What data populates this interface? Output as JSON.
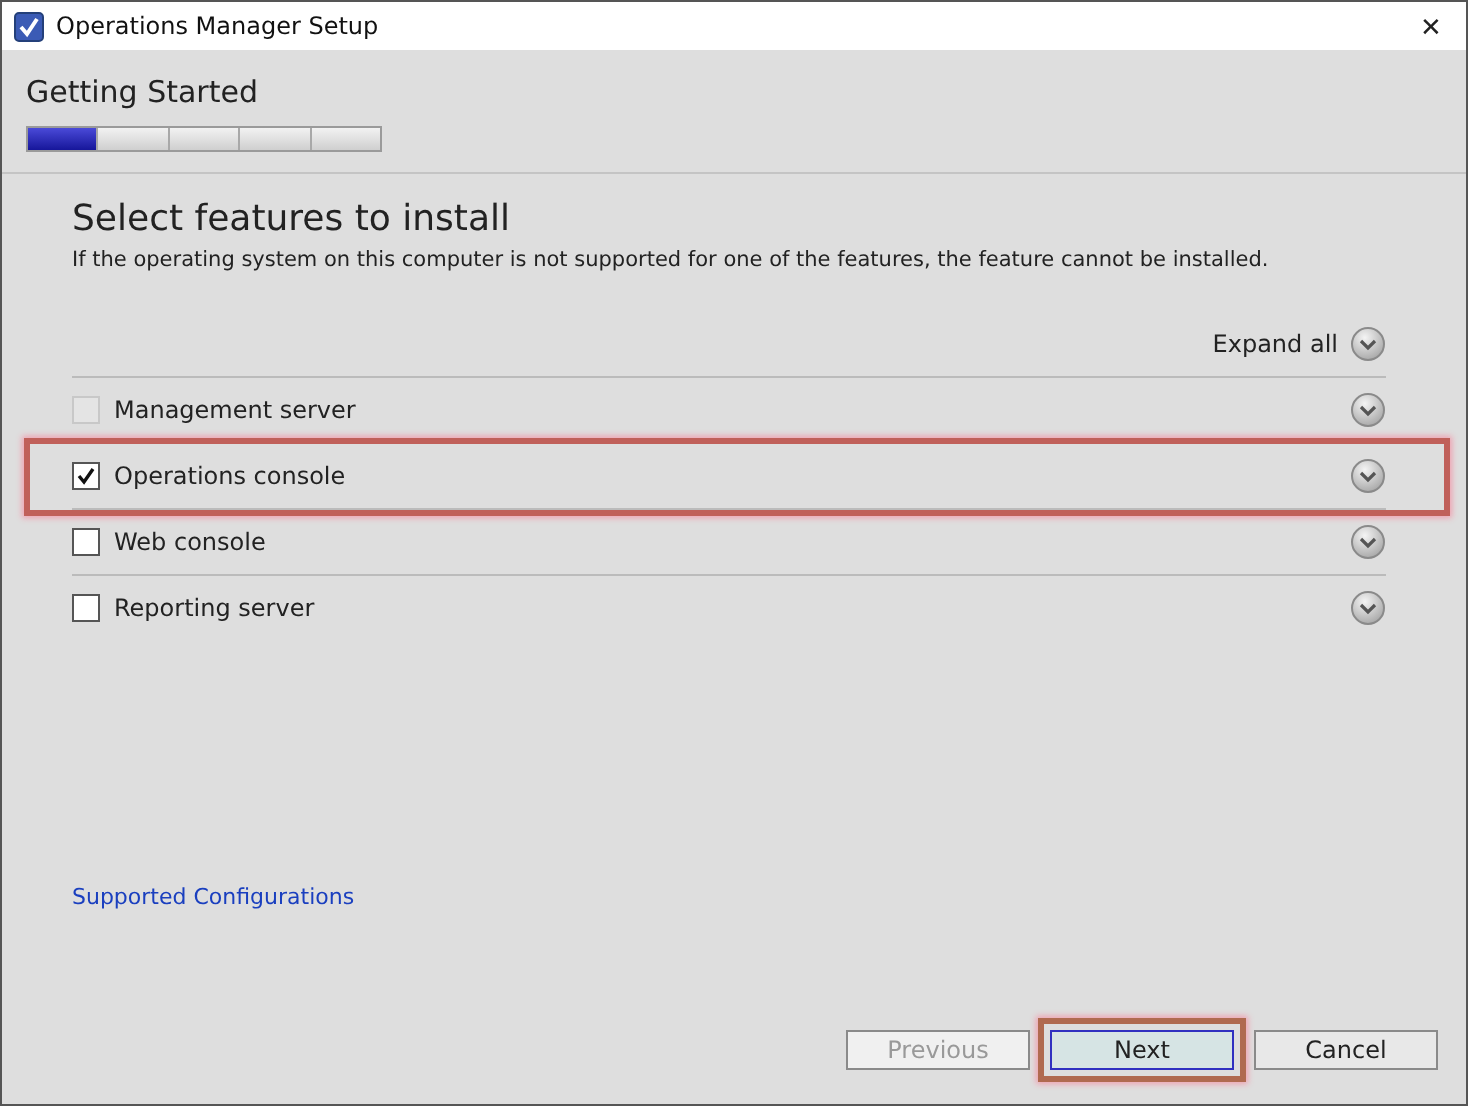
{
  "window": {
    "title": "Operations Manager Setup",
    "close": "✕"
  },
  "stage": {
    "title": "Getting Started",
    "steps": [
      {
        "current": true
      },
      {
        "current": false
      },
      {
        "current": false
      },
      {
        "current": false
      },
      {
        "current": false
      }
    ]
  },
  "heading": "Select features to install",
  "description": "If the operating system on this computer is not supported for one of the features, the feature cannot be installed.",
  "expand_all": "Expand all",
  "features": [
    {
      "label": "Management server",
      "checked": false,
      "disabled": true,
      "highlighted": false
    },
    {
      "label": "Operations console",
      "checked": true,
      "disabled": false,
      "highlighted": true
    },
    {
      "label": "Web console",
      "checked": false,
      "disabled": false,
      "highlighted": false
    },
    {
      "label": "Reporting server",
      "checked": false,
      "disabled": false,
      "highlighted": false
    }
  ],
  "link": "Supported Configurations",
  "buttons": [
    {
      "label": "Previous",
      "disabled": true,
      "default": false,
      "highlighted": false
    },
    {
      "label": "Next",
      "disabled": false,
      "default": true,
      "highlighted": true
    },
    {
      "label": "Cancel",
      "disabled": false,
      "default": false,
      "highlighted": false
    }
  ]
}
